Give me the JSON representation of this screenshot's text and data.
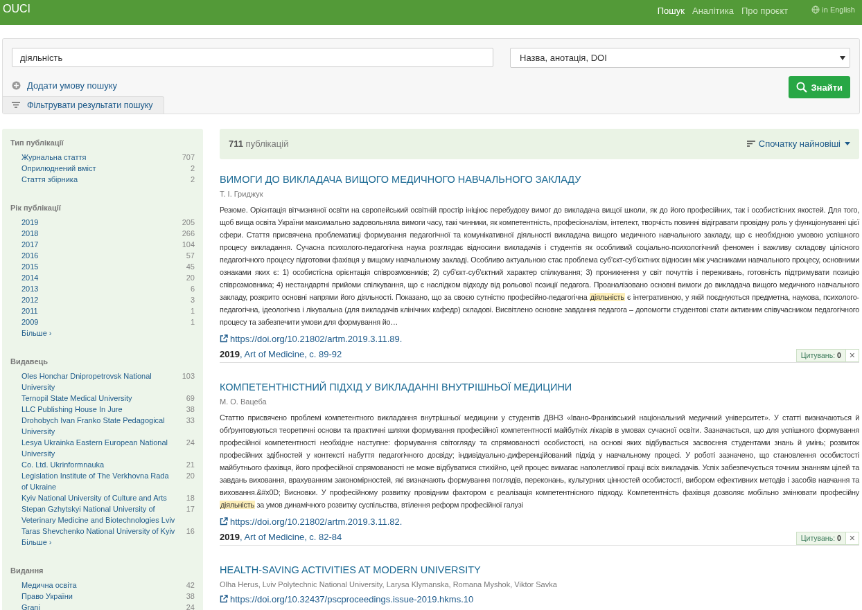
{
  "nav": {
    "brand": "OUCI",
    "links": [
      {
        "label": "Пошук",
        "selected": true
      },
      {
        "label": "Аналітика",
        "selected": false
      },
      {
        "label": "Про проєкт",
        "selected": false
      }
    ],
    "language": "in English"
  },
  "search": {
    "query": "діяльність",
    "field": "Назва, анотація, DOI",
    "add_condition": "Додати умову пошуку",
    "submit": "Знайти",
    "filter_tab": "Фільтрувати результати пошуку"
  },
  "facets": [
    {
      "title": "Тип публікації",
      "items": [
        {
          "label": "Журнальна стаття",
          "count": "707"
        },
        {
          "label": "Оприлюднений вміст",
          "count": "2"
        },
        {
          "label": "Стаття збірника",
          "count": "2"
        }
      ]
    },
    {
      "title": "Рік публікації",
      "items": [
        {
          "label": "2019",
          "count": "205"
        },
        {
          "label": "2018",
          "count": "266"
        },
        {
          "label": "2017",
          "count": "104"
        },
        {
          "label": "2016",
          "count": "57"
        },
        {
          "label": "2015",
          "count": "45"
        },
        {
          "label": "2014",
          "count": "20"
        },
        {
          "label": "2013",
          "count": "6"
        },
        {
          "label": "2012",
          "count": "3"
        },
        {
          "label": "2011",
          "count": "1"
        },
        {
          "label": "2009",
          "count": "1"
        }
      ],
      "more": "Більше ›"
    },
    {
      "title": "Видавець",
      "items": [
        {
          "label": "Oles Honchar Dnipropetrovsk National University",
          "count": "103"
        },
        {
          "label": "Ternopil State Medical University",
          "count": "69"
        },
        {
          "label": "LLC Publishing House In Jure",
          "count": "38"
        },
        {
          "label": "Drohobych Ivan Franko State Pedagogical University",
          "count": "33"
        },
        {
          "label": "Lesya Ukrainka Eastern European National University",
          "count": "24"
        },
        {
          "label": "Co. Ltd. Ukrinformnauka",
          "count": "21"
        },
        {
          "label": "Legislation Institute of The Verkhovna Rada of Ukraine",
          "count": "20"
        },
        {
          "label": "Kyiv National University of Culture and Arts",
          "count": "18"
        },
        {
          "label": "Stepan Gzhytskyi National University of Veterinary Medicine and Biotechnologies Lviv",
          "count": "17"
        },
        {
          "label": "Taras Shevchenko National University of Kyiv",
          "count": "16"
        }
      ],
      "more": "Більше ›"
    },
    {
      "title": "Видання",
      "items": [
        {
          "label": "Медична освіта",
          "count": "42"
        },
        {
          "label": "Право України",
          "count": "38"
        },
        {
          "label": "Grani",
          "count": "24"
        }
      ]
    }
  ],
  "results": {
    "count": "**711** публікацій",
    "sort": "Спочатку найновіші",
    "articles": [
      {
        "title": "ВИМОГИ ДО ВИКЛАДАЧА ВИЩОГО МЕДИЧНОГО НАВЧАЛЬНОГО ЗАКЛАДУ",
        "authors": "Т. І. Гриджук",
        "abstract": [
          {
            "text": "Резюме. Орієнтація вітчизняної освіти на європейський освітній простір ініціює перебудову вимог до викладача вищої школи, як до його професійних, так і особистісних якостей. Для того, щоб вища освіта України максимально задовольняла вимоги часу, такі чинники, як компетентність, професіоналізм, інтелект, творчість повинні відігравати провідну роль у функціонуванні цієї сфери. Стаття присвячена проблематиці формування педагогічної та комунікативної діяльності викладача вищого медичного навчального закладу, що є необхідною умовою успішного процесу викладання. Сучасна психолого-педагогічна наука розглядає відносини викладачів і студентів як особливий соціально-психологічний феномен і важливу складову цілісного педагогічного процесу підготовки фахівця у вищому навчальному закладі. Особливо актуальною стає проблема суб'єкт-суб'єктних відносин між учасниками навчального процесу, основними ознаками яких є: 1) особистісна орієнтація співрозмовників; 2) суб'єкт-суб'єктний характер спілкування; 3) проникнення у світ почуттів і переживань, готовність підтримувати позицію співрозмовника; 4) нестандартні прийоми спілкування, що є наслідком відходу від рольової позиції педагога. Проаналізовано основні вимоги до викладача вищого медичного навчального закладу, розкрито основні напрями його діяльності. Показано, що за своєю сутністю професійно-педагогічна ",
            "highlight": false
          },
          {
            "text": "діяльність",
            "highlight": true
          },
          {
            "text": " є інтегративною, у якій поєднуються предметна, наукова, психолого-педагогічна, ідеологічна і лікувальна (для викладачів клінічних кафедр) складові. Висвітлено основне завдання педагога – допомогти студентові стати активним співучасником педагогічного процесу та забезпечити умови для формування йо…",
            "highlight": false
          }
        ],
        "doi": "https://doi.org/10.21802/artm.2019.3.11.89.",
        "meta": "**2019**, Art of Medicine, с. 89-92",
        "citations": "Цитувань: **0**",
        "dismiss": "×"
      },
      {
        "title": "КОМПЕТЕНТНІСТНИЙ ПІДХІД У ВИКЛАДАННІ ВНУТРІШНЬОЇ МЕДИЦИНИ",
        "authors": "М. О. Вацеба",
        "abstract": [
          {
            "text": "Статтю присвячено проблемі компетентного викладання внутрішньої медицини у студентів ДВНЗ «Івано-Франківський національний медичний університет». У статті визначаються й обґрунтовуються теоретичні основи та практичні шляхи формування професійної компетентності майбутніх лікарів в умовах сучасної освіти. Зазначається, що для успішного формування професійної компетентності необхідне наступне: формування світогляду та спрямованості особистості, на основі яких відбувається засвоєння студентами знань й умінь; розвиток професійних здібностей у контексті набуття педагогічного досвіду; індивідуально-диференційований підхід у навчальному процесі. У роботі зазначено, що становлення особистості майбутнього фахівця, його професійної спрямованості не може відбуватися стихійно, цей процес вимагає наполегливої праці всіх викладачів. Успіх забезпечується точним знанням цілей та завдань виховання, врахуванням закономірностей, які визначають формування поглядів, переконань, культурних цінностей особистості, вибором ефективних методів і засобів навчання та виховання.&#x0D; Висновки. У професійному розвитку провідним фактором є реалізація компетентнісного підходу. Компетентність фахівця дозволяє мобільно змінювати професійну ",
            "highlight": false
          },
          {
            "text": "діяльність",
            "highlight": true
          },
          {
            "text": " за умов динамічного розвитку суспільства, втілення реформ професійної галузі",
            "highlight": false
          }
        ],
        "doi": "https://doi.org/10.21802/artm.2019.3.11.82.",
        "meta": "**2019**, Art of Medicine, с. 82-84",
        "citations": "Цитувань: **0**",
        "dismiss": "×"
      },
      {
        "title": "HEALTH-SAVING ACTIVITIES AT MODERN UNIVERSITY",
        "authors": "Olha Herus, Lviv Polytechnic National University, Larysa Klymanska, Romana Myshok, Viktor Savka",
        "doi": "https://doi.org/10.32437/pscproceedings.issue-2019.hkms.10"
      }
    ]
  }
}
